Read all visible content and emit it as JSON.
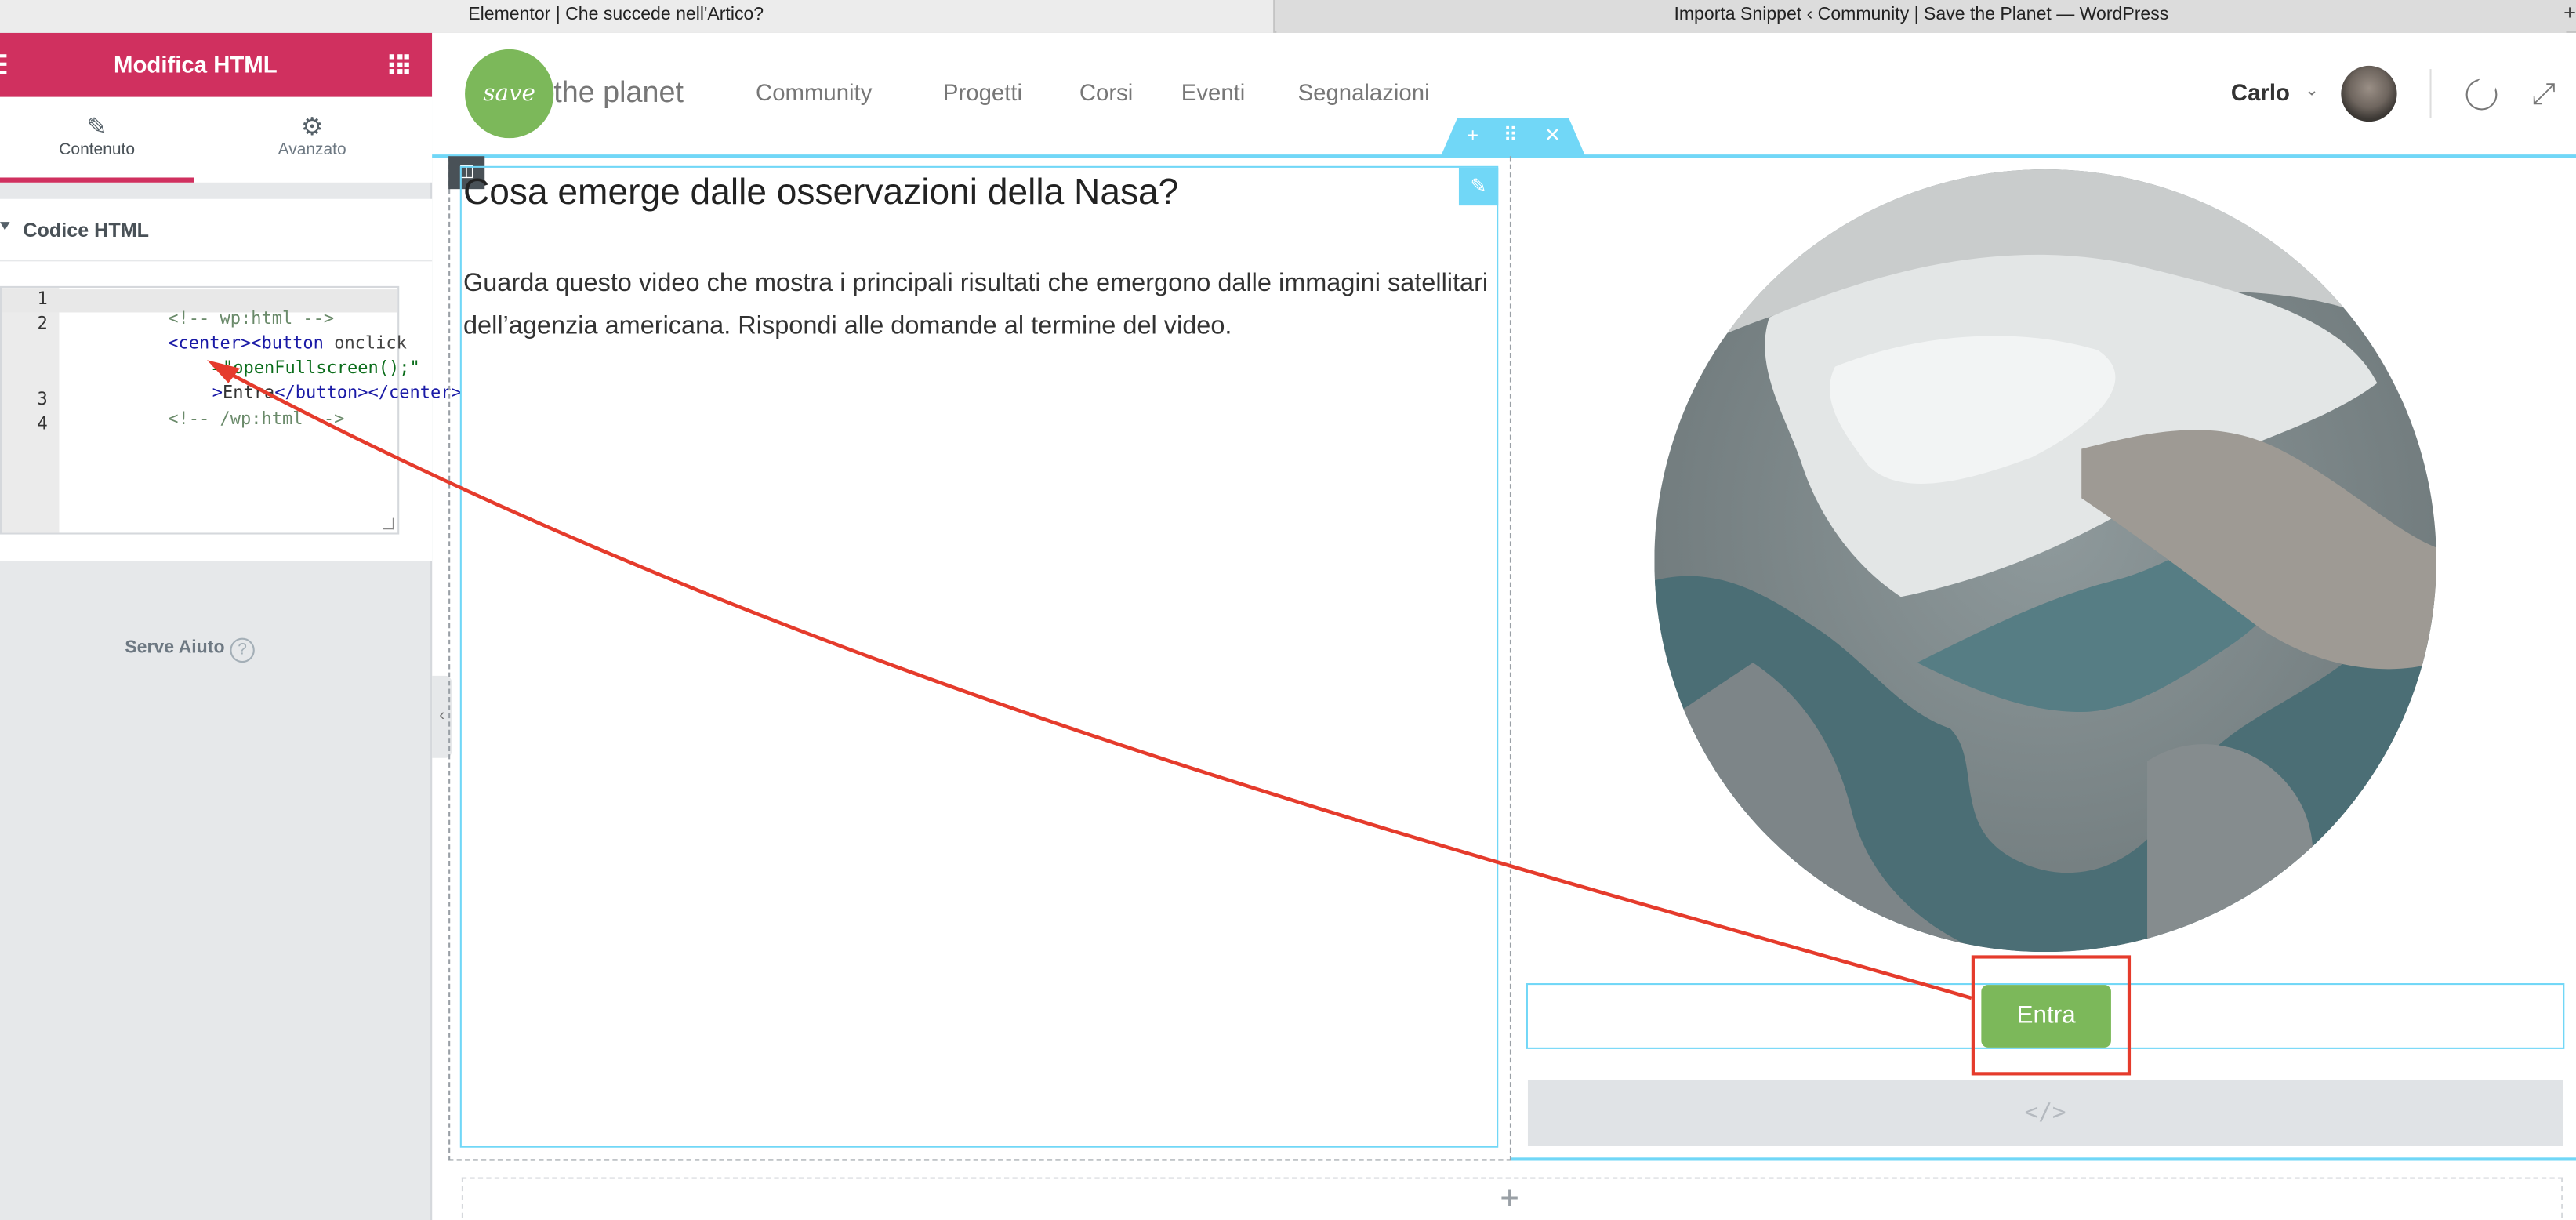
{
  "browser_tabs": [
    {
      "title": "Elementor | Che succede nell'Artico?"
    },
    {
      "title": "Importa Snippet ‹ Community | Save the Planet — WordPress"
    }
  ],
  "browser": {
    "new_tab": "+"
  },
  "sidebar": {
    "title": "Modifica HTML",
    "tabs": [
      {
        "label": "Contenuto"
      },
      {
        "label": "Avanzato"
      }
    ],
    "section_label": "Codice HTML",
    "help_label": "Serve Aiuto",
    "help_icon": "?"
  },
  "code": {
    "line_numbers": [
      "1",
      "2",
      "",
      "",
      "3",
      "4"
    ],
    "lines": {
      "l1_comment": "<!-- wp:html -->",
      "l2_tag_open": "<center><button",
      "l2_attr": " onclick",
      "l2b_str": "=\"openFullscreen();\"",
      "l2c_gt": ">",
      "l2c_text": "Entra",
      "l2c_tag_close": "</button></center>",
      "l3_comment": "<!-- /wp:html -->"
    }
  },
  "site": {
    "logo_word": "save",
    "logo_text": "the planet",
    "nav": [
      {
        "label": "Community"
      },
      {
        "label": "Progetti"
      },
      {
        "label": "Corsi"
      },
      {
        "label": "Eventi"
      },
      {
        "label": "Segnalazioni"
      }
    ],
    "user_name": "Carlo"
  },
  "content": {
    "heading": "Cosa emerge dalle osservazioni della Nasa?",
    "paragraph": "Guarda questo video che mostra i principali risultati che emergono dalle immagini satellitari dell’agenzia americana. Rispondi alle domande al termine del video.",
    "button_label": "Entra",
    "html_placeholder": "</>",
    "add_section": "+"
  },
  "colors": {
    "elementor_pink": "#d0305f",
    "brand_green": "#7cb85a",
    "selection_blue": "#71d7f7",
    "annotation_red": "#e53b2c"
  },
  "icons": {
    "menu": "hamburger-icon",
    "widgets": "grid-icon",
    "content_tab": "pencil-icon",
    "advanced_tab": "gear-icon",
    "help": "question-circle-icon",
    "theme": "moon-icon",
    "fullscreen": "expand-icon",
    "add": "plus-icon",
    "move": "drag-handle-icon",
    "delete": "close-icon",
    "column": "column-icon",
    "edit": "pencil-icon"
  }
}
